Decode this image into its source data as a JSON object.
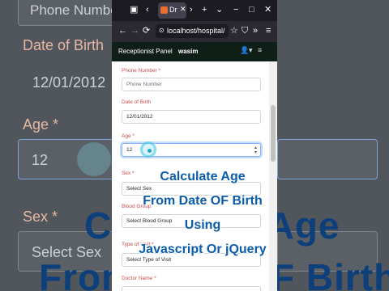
{
  "background": {
    "phone_label": "Phone Number",
    "dob_label": "Date of Birth",
    "dob_value": "12/01/2012",
    "age_label": "Age *",
    "age_value": "12",
    "sex_label": "Sex *",
    "sex_value": "Select Sex",
    "big_line1": "Calculate Age",
    "big_line2": "From Date OF Birth"
  },
  "browser": {
    "tab_title": "Dr",
    "tab_close": "✕",
    "url": "localhost/hospital/",
    "new_tab": "+",
    "menu": "≡",
    "minimize": "−",
    "maximize": "□",
    "close": "✕",
    "back": "←",
    "forward": "→",
    "reload": "⟳"
  },
  "app": {
    "panel_title": "Receptionist Panel",
    "user": "wasim",
    "user_menu": "▾",
    "menu_icon": "≡"
  },
  "form": {
    "phone_label": "Phone Number",
    "phone_placeholder": "Phone Number",
    "dob_label": "Date of Birth",
    "dob_value": "12/01/2012",
    "age_label": "Age",
    "age_value": "12",
    "sex_label": "Sex",
    "sex_value": "Select Sex",
    "blood_label": "Blood Group",
    "blood_value": "Select Blood Group",
    "visit_label": "Type of Visit",
    "visit_value": "Select Type of Visit",
    "doctor_label": "Doctor Name",
    "required_star": "*"
  },
  "caption": {
    "line1": "Calculate Age",
    "line2": "From Date OF Birth",
    "line3": "Using",
    "line4": "Javascript Or jQuery"
  }
}
